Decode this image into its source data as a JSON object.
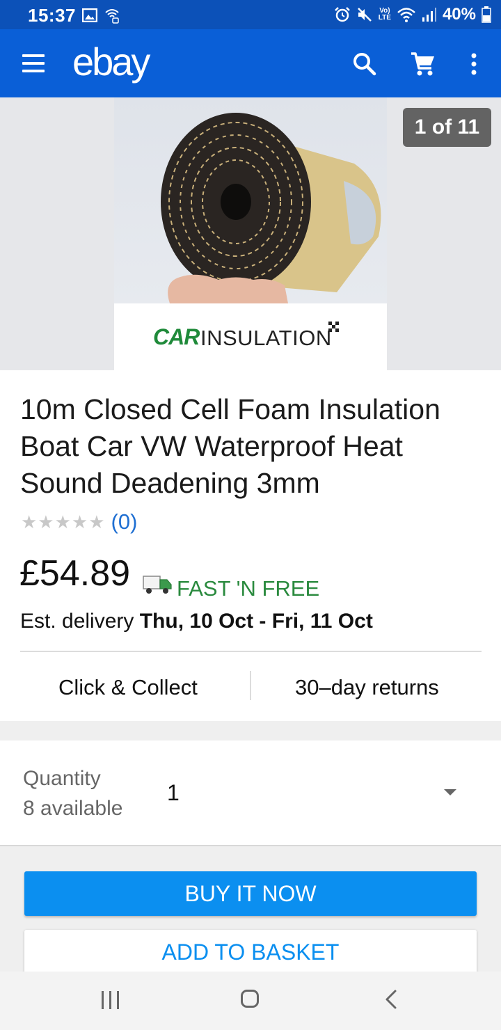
{
  "status_bar": {
    "time": "15:37",
    "battery": "40%",
    "network": "LTE",
    "icons": [
      "image-icon",
      "wifi-call-icon",
      "alarm-icon",
      "mute-icon",
      "volte-icon",
      "wifi-icon",
      "signal-icon",
      "battery-icon"
    ]
  },
  "app_bar": {
    "logo": "ebay",
    "icons": [
      "menu-icon",
      "search-icon",
      "cart-icon",
      "more-vert-icon"
    ]
  },
  "gallery": {
    "counter": "1 of 11",
    "brand_car": "CAR",
    "brand_insulation": "INSULATION"
  },
  "product": {
    "title": "10m Closed Cell Foam Insulation Boat Car VW Waterproof Heat Sound Deadening 3mm",
    "stars": "★★★★★",
    "rating_count": "(0)",
    "price": "£54.89",
    "shipping": "FAST 'N FREE",
    "delivery_prefix": "Est. delivery",
    "delivery_dates": "Thu, 10 Oct - Fri, 11 Oct",
    "feature_left": "Click & Collect",
    "feature_right": "30–day returns"
  },
  "quantity": {
    "label": "Quantity",
    "available": "8 available",
    "value": "1"
  },
  "actions": {
    "buy_now": "BUY IT NOW",
    "add_to_basket": "ADD TO BASKET"
  },
  "colors": {
    "status_bar": "#0c51b8",
    "app_bar": "#0a5fd7",
    "accent": "#0b8ff0",
    "shipping_green": "#2a8a3e",
    "link": "#1f6fd2"
  }
}
